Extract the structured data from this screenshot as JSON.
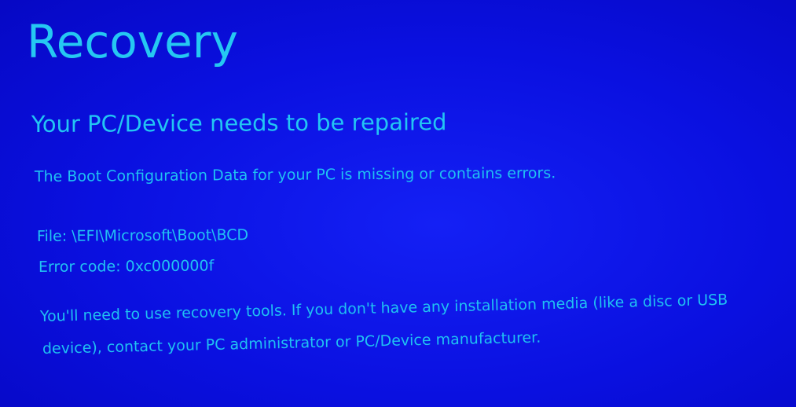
{
  "screen": {
    "title": "Recovery",
    "subtitle": "Your PC/Device needs to be repaired",
    "description": "The Boot Configuration Data for your PC is missing or contains errors.",
    "file_label": "File:",
    "file_path": "\\EFI\\Microsoft\\Boot\\BCD",
    "error_label": "Error code:",
    "error_code": "0xc000000f",
    "help_line_1": "You'll need to use recovery tools. If you don't have any installation media (like a disc or USB",
    "help_line_2": "device), contact your PC administrator or PC/Device manufacturer."
  },
  "colors": {
    "background": "#0a12e8",
    "text": "#22c6f3"
  }
}
